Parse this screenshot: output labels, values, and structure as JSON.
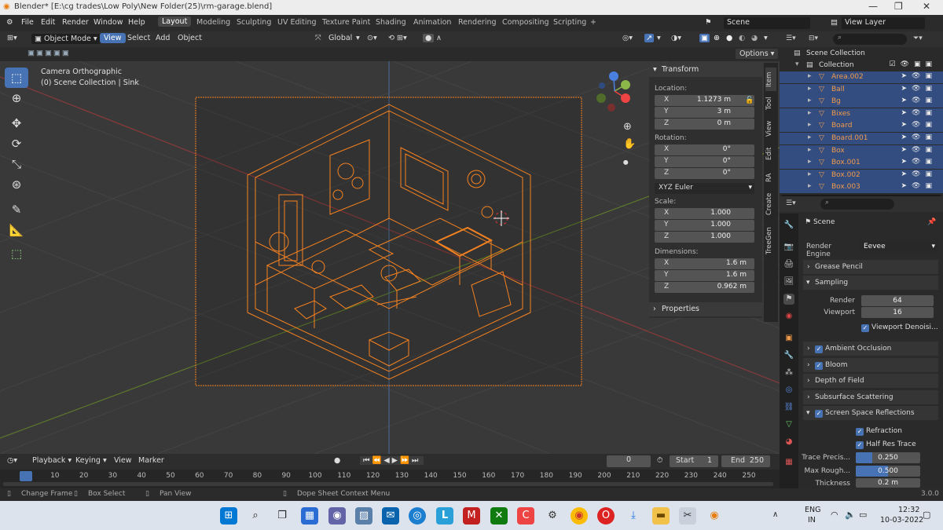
{
  "window": {
    "title": "Blender* [E:\\cg trades\\Low Poly\\New Folder(25)\\rm-garage.blend]",
    "min": "—",
    "max": "❐",
    "close": "✕"
  },
  "menu": [
    "File",
    "Edit",
    "Render",
    "Window",
    "Help"
  ],
  "workspaces": [
    "Layout",
    "Modeling",
    "Sculpting",
    "UV Editing",
    "Texture Paint",
    "Shading",
    "Animation",
    "Rendering",
    "Compositing",
    "Scripting",
    "+"
  ],
  "scene": {
    "label": "Scene",
    "view_layer": "View Layer"
  },
  "viewport_header": {
    "mode": "Object Mode",
    "view": "View",
    "select": "Select",
    "add": "Add",
    "object": "Object",
    "orientation": "Global",
    "options": "Options"
  },
  "viewport": {
    "camera_label": "Camera Orthographic",
    "collection_label": "(0) Scene Collection | Sink"
  },
  "npanel": {
    "transform": "Transform",
    "location_label": "Location:",
    "location": [
      {
        "axis": "X",
        "value": "1.1273 m"
      },
      {
        "axis": "Y",
        "value": "3 m"
      },
      {
        "axis": "Z",
        "value": "0 m"
      }
    ],
    "rotation_label": "Rotation:",
    "rotation": [
      {
        "axis": "X",
        "value": "0°"
      },
      {
        "axis": "Y",
        "value": "0°"
      },
      {
        "axis": "Z",
        "value": "0°"
      }
    ],
    "rotation_mode": "XYZ Euler",
    "scale_label": "Scale:",
    "scale": [
      {
        "axis": "X",
        "value": "1.000"
      },
      {
        "axis": "Y",
        "value": "1.000"
      },
      {
        "axis": "Z",
        "value": "1.000"
      }
    ],
    "dimensions_label": "Dimensions:",
    "dimensions": [
      {
        "axis": "X",
        "value": "1.6 m"
      },
      {
        "axis": "Y",
        "value": "1.6 m"
      },
      {
        "axis": "Z",
        "value": "0.962 m"
      }
    ],
    "properties": "Properties"
  },
  "ntabs": [
    "Item",
    "Tool",
    "View",
    "Edit",
    "RA",
    "Create",
    "TreeGen"
  ],
  "outliner": {
    "scene_collection": "Scene Collection",
    "collection": "Collection",
    "items": [
      "Area.002",
      "Ball",
      "Bg",
      "Bixes",
      "Board",
      "Board.001",
      "Box",
      "Box.001",
      "Box.002",
      "Box.003"
    ]
  },
  "properties": {
    "scene": "Scene",
    "render_engine_label": "Render Engine",
    "render_engine": "Eevee",
    "grease_pencil": "Grease Pencil",
    "sampling": "Sampling",
    "render_label": "Render",
    "render_value": "64",
    "viewport_label": "Viewport",
    "viewport_value": "16",
    "viewport_denoise": "Viewport Denoisi...",
    "ambient_occlusion": "Ambient Occlusion",
    "bloom": "Bloom",
    "depth_of_field": "Depth of Field",
    "subsurface_scattering": "Subsurface Scattering",
    "ssr": "Screen Space Reflections",
    "refraction": "Refraction",
    "half_res_trace": "Half Res Trace",
    "trace_precision_label": "Trace Precis...",
    "trace_precision": "0.250",
    "trace_precision_fill": 0.25,
    "max_roughness_label": "Max Rough...",
    "max_roughness": "0.500",
    "max_roughness_fill": 0.5,
    "thickness_label": "Thickness",
    "thickness": "0.2 m"
  },
  "timeline": {
    "playback": "Playback",
    "keying": "Keying",
    "view": "View",
    "marker": "Marker",
    "current_frame": "0",
    "start_label": "Start",
    "start": "1",
    "end_label": "End",
    "end": "250",
    "ticks": [
      "0",
      "10",
      "20",
      "30",
      "40",
      "50",
      "60",
      "70",
      "80",
      "90",
      "100",
      "110",
      "120",
      "130",
      "140",
      "150",
      "160",
      "170",
      "180",
      "190",
      "200",
      "210",
      "220",
      "230",
      "240",
      "250"
    ]
  },
  "status": {
    "change_frame": "Change Frame",
    "box_select": "Box Select",
    "pan_view": "Pan View",
    "context_menu": "Dope Sheet Context Menu",
    "version": "3.0.0"
  },
  "taskbar": {
    "lang": "ENG",
    "region": "IN",
    "time": "12:32",
    "date": "10-03-2022"
  },
  "colors": {
    "accent": "#4772b3",
    "selection": "#f58220",
    "bg": "#393939"
  }
}
